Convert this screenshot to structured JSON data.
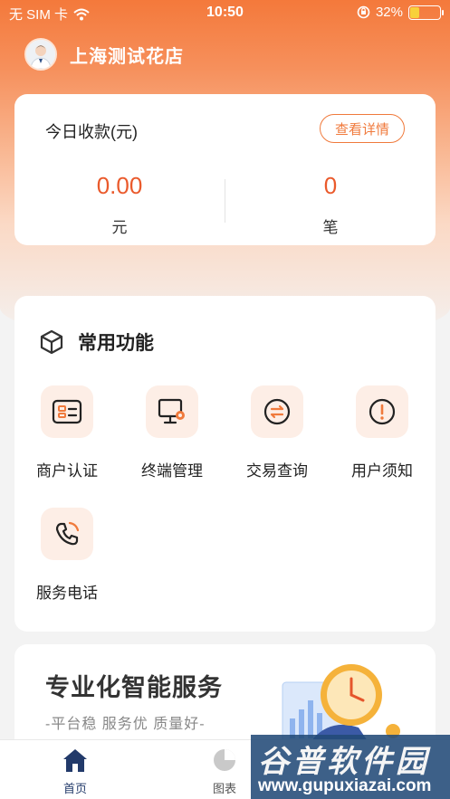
{
  "status_bar": {
    "carrier": "无 SIM 卡",
    "time": "10:50",
    "battery": "32%",
    "battery_level": 0.32
  },
  "store": {
    "name": "上海测试花店"
  },
  "income": {
    "title": "今日收款(元)",
    "detail_button": "查看详情",
    "amount": "0.00",
    "amount_unit": "元",
    "count": "0",
    "count_unit": "笔"
  },
  "functions": {
    "title": "常用功能",
    "items": [
      {
        "label": "商户认证",
        "icon": "id-card-icon"
      },
      {
        "label": "终端管理",
        "icon": "terminal-settings-icon"
      },
      {
        "label": "交易查询",
        "icon": "exchange-icon"
      },
      {
        "label": "用户须知",
        "icon": "alert-icon"
      },
      {
        "label": "服务电话",
        "icon": "phone-icon"
      }
    ]
  },
  "promo": {
    "title": "专业化智能服务",
    "subtitle": "-平台稳  服务优  质量好-"
  },
  "tabbar": {
    "items": [
      {
        "label": "首页",
        "active": true
      },
      {
        "label": "图表",
        "active": false
      }
    ]
  },
  "watermark": {
    "title": "谷普软件园",
    "url": "www.gupuxiazai.com"
  },
  "colors": {
    "accent": "#f07a3c",
    "number": "#ea5a2c",
    "icon_bg": "#fdeee6",
    "tab_active": "#223a6a"
  }
}
